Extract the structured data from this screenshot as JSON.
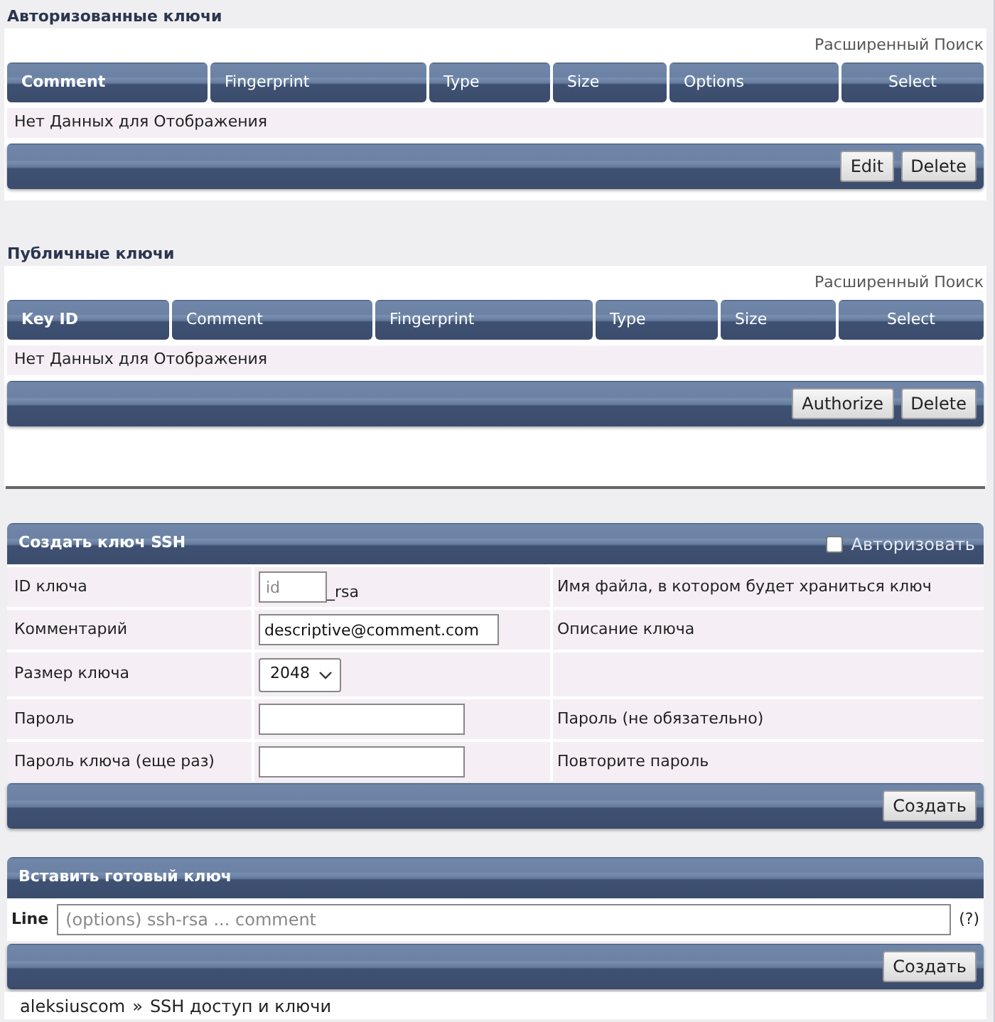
{
  "authorized_keys": {
    "title": "Авторизованные ключи",
    "advanced_search": "Расширенный Поиск",
    "columns": [
      {
        "label": "Comment",
        "kind": "data",
        "sorted": true
      },
      {
        "label": "Fingerprint",
        "kind": "data",
        "sorted": false
      },
      {
        "label": "Type",
        "kind": "data",
        "sorted": false
      },
      {
        "label": "Size",
        "kind": "data",
        "sorted": false
      },
      {
        "label": "Options",
        "kind": "data",
        "sorted": false
      },
      {
        "label": "Select",
        "kind": "select",
        "sorted": false
      }
    ],
    "empty_message": "Нет Данных для Отображения",
    "buttons": [
      "Edit",
      "Delete"
    ]
  },
  "public_keys": {
    "title": "Публичные ключи",
    "advanced_search": "Расширенный Поиск",
    "columns": [
      {
        "label": "Key ID",
        "kind": "data",
        "sorted": true
      },
      {
        "label": "Comment",
        "kind": "data",
        "sorted": false
      },
      {
        "label": "Fingerprint",
        "kind": "data",
        "sorted": false
      },
      {
        "label": "Type",
        "kind": "data",
        "sorted": false
      },
      {
        "label": "Size",
        "kind": "data",
        "sorted": false
      },
      {
        "label": "Select",
        "kind": "select",
        "sorted": false
      }
    ],
    "empty_message": "Нет Данных для Отображения",
    "buttons": [
      "Authorize",
      "Delete"
    ]
  },
  "create_key": {
    "title": "Создать ключ SSH",
    "authorize": {
      "label": "Авторизовать",
      "checked": false
    },
    "rows": [
      {
        "kind": "id",
        "label": "ID ключа",
        "placeholder": "id",
        "suffix": "_rsa",
        "description": "Имя файла, в котором будет храниться ключ"
      },
      {
        "kind": "text",
        "label": "Комментарий",
        "value": "descriptive@comment.com",
        "description": "Описание ключа"
      },
      {
        "kind": "select",
        "label": "Размер ключа",
        "value": "2048"
      },
      {
        "kind": "password",
        "label": "Пароль",
        "description": "Пароль (не обязательно)"
      },
      {
        "kind": "password",
        "label": "Пароль ключа (еще раз)",
        "description": "Повторите пароль"
      }
    ],
    "buttons": [
      "Создать"
    ]
  },
  "import_key": {
    "title": "Вставить готовый ключ",
    "line_label": "Line",
    "placeholder": "(options) ssh-rsa ... comment",
    "help": "(?)",
    "buttons": [
      "Создать"
    ]
  },
  "breadcrumb": {
    "items": [
      {
        "label": "aleksiuscom"
      },
      {
        "label": "SSH доступ и ключи"
      }
    ],
    "separator": "»"
  }
}
